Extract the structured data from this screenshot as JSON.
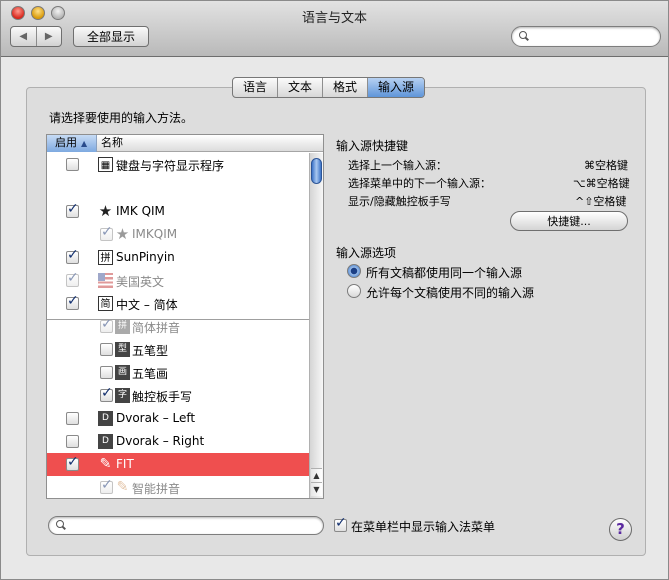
{
  "window": {
    "title": "语言与文本"
  },
  "toolbar": {
    "back": "◀",
    "forward": "▶",
    "show_all": "全部显示",
    "search_placeholder": ""
  },
  "tabs": [
    {
      "label": "语言",
      "selected": false
    },
    {
      "label": "文本",
      "selected": false
    },
    {
      "label": "格式",
      "selected": false
    },
    {
      "label": "输入源",
      "selected": true
    }
  ],
  "prompt": "请选择要使用的输入方法。",
  "list": {
    "col_enabled": "启用",
    "col_name": "名称",
    "sort_icon": "▲",
    "items": [
      {
        "label": "键盘与字符显示程序",
        "checked": false,
        "dim": false,
        "icon": "keyboard-viewer-icon",
        "glyph": "▦"
      },
      {
        "label": "IMK QIM",
        "checked": true,
        "dim": false,
        "icon": "star-icon",
        "glyph": "★"
      },
      {
        "label": "IMKQIM",
        "checked": true,
        "dim": true,
        "icon": "star-icon",
        "glyph": "★"
      },
      {
        "label": "SunPinyin",
        "checked": true,
        "dim": false,
        "icon": "pinyin-icon",
        "glyph": "拼"
      },
      {
        "label": "美国英文",
        "checked": true,
        "dim": true,
        "icon": "us-flag-icon",
        "glyph": ""
      },
      {
        "label": "中文 – 简体",
        "checked": true,
        "dim": false,
        "icon": "simplified-icon",
        "glyph": "简"
      },
      {
        "label": "简体拼音",
        "checked": true,
        "dim": true,
        "icon": "pinyin-icon",
        "glyph": "拼"
      },
      {
        "label": "五笔型",
        "checked": false,
        "dim": false,
        "icon": "wubi-icon",
        "glyph": "型"
      },
      {
        "label": "五笔画",
        "checked": false,
        "dim": false,
        "icon": "stroke-icon",
        "glyph": "画"
      },
      {
        "label": "触控板手写",
        "checked": true,
        "dim": false,
        "icon": "handwriting-icon",
        "glyph": "字"
      },
      {
        "label": "Dvorak – Left",
        "checked": false,
        "dim": false,
        "icon": "dvorak-icon",
        "glyph": "D"
      },
      {
        "label": "Dvorak – Right",
        "checked": false,
        "dim": false,
        "icon": "dvorak-icon",
        "glyph": "D"
      },
      {
        "label": "FIT",
        "checked": true,
        "dim": false,
        "icon": "brush-icon",
        "glyph": "✎",
        "selected": true
      },
      {
        "label": "智能拼音",
        "checked": true,
        "dim": true,
        "icon": "brush-icon",
        "glyph": "✎"
      }
    ]
  },
  "shortcuts": {
    "heading": "输入源快捷键",
    "rows": [
      {
        "label": "选择上一个输入源：",
        "key": "⌘空格键"
      },
      {
        "label": "选择菜单中的下一个输入源：",
        "key": "⌥⌘空格键"
      },
      {
        "label": "显示/隐藏触控板手写",
        "key": "^⇧空格键"
      }
    ],
    "button": "快捷键..."
  },
  "options": {
    "heading": "输入源选项",
    "radio1": "所有文稿都使用同一个输入源",
    "radio2": "允许每个文稿使用不同的输入源"
  },
  "bottom": {
    "show_menu": "在菜单栏中显示输入法菜单",
    "search_placeholder": "",
    "help": "?"
  }
}
